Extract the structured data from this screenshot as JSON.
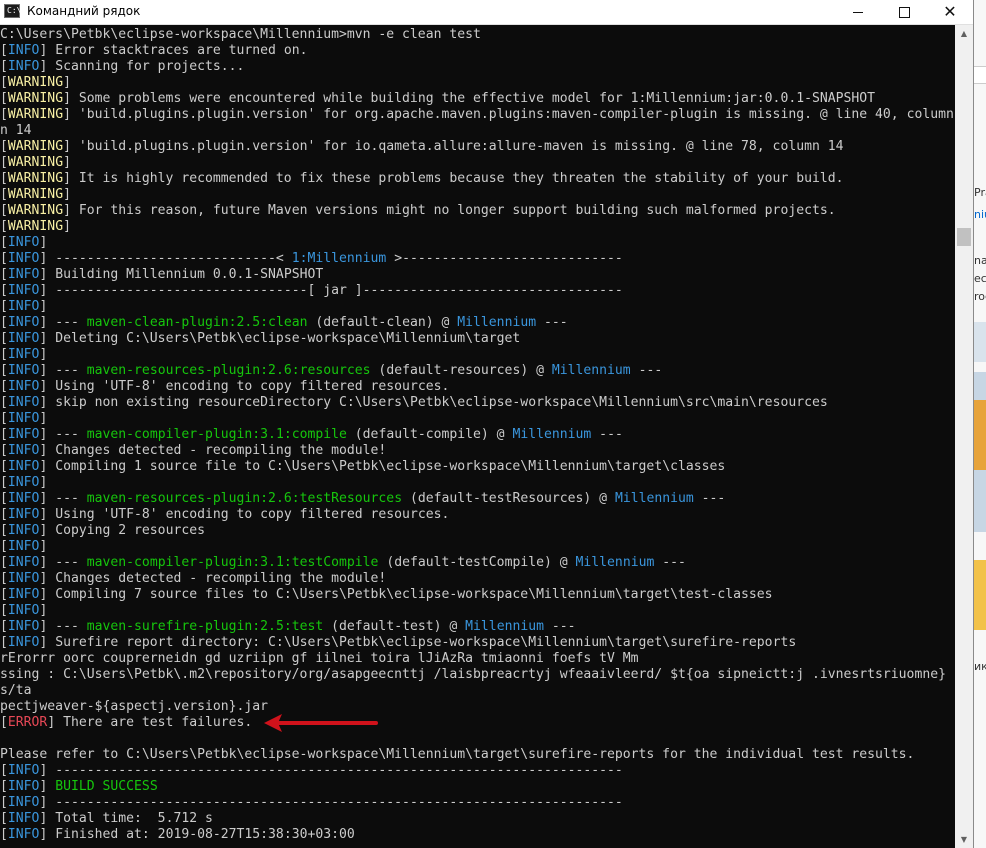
{
  "window": {
    "title": "Командний рядок",
    "controls": {
      "minimize": "minimize",
      "maximize": "maximize",
      "close": "✕"
    },
    "icon_text": "C:\\"
  },
  "console_lines": [
    [
      {
        "t": "C:\\Users\\Petbk\\eclipse-workspace\\Millennium>mvn -e clean test",
        "c": ""
      }
    ],
    [
      {
        "t": "[",
        "c": ""
      },
      {
        "t": "INFO",
        "c": "c-info"
      },
      {
        "t": "] Error stacktraces are turned on.",
        "c": ""
      }
    ],
    [
      {
        "t": "[",
        "c": ""
      },
      {
        "t": "INFO",
        "c": "c-info"
      },
      {
        "t": "] Scanning for projects...",
        "c": ""
      }
    ],
    [
      {
        "t": "[",
        "c": ""
      },
      {
        "t": "WARNING",
        "c": "c-warn"
      },
      {
        "t": "]",
        "c": ""
      }
    ],
    [
      {
        "t": "[",
        "c": ""
      },
      {
        "t": "WARNING",
        "c": "c-warn"
      },
      {
        "t": "] Some problems were encountered while building the effective model for 1:Millennium:jar:0.0.1-SNAPSHOT",
        "c": ""
      }
    ],
    [
      {
        "t": "[",
        "c": ""
      },
      {
        "t": "WARNING",
        "c": "c-warn"
      },
      {
        "t": "] 'build.plugins.plugin.version' for org.apache.maven.plugins:maven-compiler-plugin is missing. @ line 40, column",
        "c": ""
      }
    ],
    [
      {
        "t": "n 14",
        "c": ""
      }
    ],
    [
      {
        "t": "[",
        "c": ""
      },
      {
        "t": "WARNING",
        "c": "c-warn"
      },
      {
        "t": "] 'build.plugins.plugin.version' for io.qameta.allure:allure-maven is missing. @ line 78, column 14",
        "c": ""
      }
    ],
    [
      {
        "t": "[",
        "c": ""
      },
      {
        "t": "WARNING",
        "c": "c-warn"
      },
      {
        "t": "]",
        "c": ""
      }
    ],
    [
      {
        "t": "[",
        "c": ""
      },
      {
        "t": "WARNING",
        "c": "c-warn"
      },
      {
        "t": "] It is highly recommended to fix these problems because they threaten the stability of your build.",
        "c": ""
      }
    ],
    [
      {
        "t": "[",
        "c": ""
      },
      {
        "t": "WARNING",
        "c": "c-warn"
      },
      {
        "t": "]",
        "c": ""
      }
    ],
    [
      {
        "t": "[",
        "c": ""
      },
      {
        "t": "WARNING",
        "c": "c-warn"
      },
      {
        "t": "] For this reason, future Maven versions might no longer support building such malformed projects.",
        "c": ""
      }
    ],
    [
      {
        "t": "[",
        "c": ""
      },
      {
        "t": "WARNING",
        "c": "c-warn"
      },
      {
        "t": "]",
        "c": ""
      }
    ],
    [
      {
        "t": "[",
        "c": ""
      },
      {
        "t": "INFO",
        "c": "c-info"
      },
      {
        "t": "]",
        "c": ""
      }
    ],
    [
      {
        "t": "[",
        "c": ""
      },
      {
        "t": "INFO",
        "c": "c-info"
      },
      {
        "t": "] ----------------------------< ",
        "c": ""
      },
      {
        "t": "1:Millennium",
        "c": "c-blue"
      },
      {
        "t": " >----------------------------",
        "c": ""
      }
    ],
    [
      {
        "t": "[",
        "c": ""
      },
      {
        "t": "INFO",
        "c": "c-info"
      },
      {
        "t": "] Building Millennium 0.0.1-SNAPSHOT",
        "c": ""
      }
    ],
    [
      {
        "t": "[",
        "c": ""
      },
      {
        "t": "INFO",
        "c": "c-info"
      },
      {
        "t": "] --------------------------------[ jar ]---------------------------------",
        "c": ""
      }
    ],
    [
      {
        "t": "[",
        "c": ""
      },
      {
        "t": "INFO",
        "c": "c-info"
      },
      {
        "t": "]",
        "c": ""
      }
    ],
    [
      {
        "t": "[",
        "c": ""
      },
      {
        "t": "INFO",
        "c": "c-info"
      },
      {
        "t": "] --- ",
        "c": ""
      },
      {
        "t": "maven-clean-plugin:2.5:clean",
        "c": "c-green"
      },
      {
        "t": " (default-clean) @ ",
        "c": ""
      },
      {
        "t": "Millennium",
        "c": "c-blue"
      },
      {
        "t": " ---",
        "c": ""
      }
    ],
    [
      {
        "t": "[",
        "c": ""
      },
      {
        "t": "INFO",
        "c": "c-info"
      },
      {
        "t": "] Deleting C:\\Users\\Petbk\\eclipse-workspace\\Millennium\\target",
        "c": ""
      }
    ],
    [
      {
        "t": "[",
        "c": ""
      },
      {
        "t": "INFO",
        "c": "c-info"
      },
      {
        "t": "]",
        "c": ""
      }
    ],
    [
      {
        "t": "[",
        "c": ""
      },
      {
        "t": "INFO",
        "c": "c-info"
      },
      {
        "t": "] --- ",
        "c": ""
      },
      {
        "t": "maven-resources-plugin:2.6:resources",
        "c": "c-green"
      },
      {
        "t": " (default-resources) @ ",
        "c": ""
      },
      {
        "t": "Millennium",
        "c": "c-blue"
      },
      {
        "t": " ---",
        "c": ""
      }
    ],
    [
      {
        "t": "[",
        "c": ""
      },
      {
        "t": "INFO",
        "c": "c-info"
      },
      {
        "t": "] Using 'UTF-8' encoding to copy filtered resources.",
        "c": ""
      }
    ],
    [
      {
        "t": "[",
        "c": ""
      },
      {
        "t": "INFO",
        "c": "c-info"
      },
      {
        "t": "] skip non existing resourceDirectory C:\\Users\\Petbk\\eclipse-workspace\\Millennium\\src\\main\\resources",
        "c": ""
      }
    ],
    [
      {
        "t": "[",
        "c": ""
      },
      {
        "t": "INFO",
        "c": "c-info"
      },
      {
        "t": "]",
        "c": ""
      }
    ],
    [
      {
        "t": "[",
        "c": ""
      },
      {
        "t": "INFO",
        "c": "c-info"
      },
      {
        "t": "] --- ",
        "c": ""
      },
      {
        "t": "maven-compiler-plugin:3.1:compile",
        "c": "c-green"
      },
      {
        "t": " (default-compile) @ ",
        "c": ""
      },
      {
        "t": "Millennium",
        "c": "c-blue"
      },
      {
        "t": " ---",
        "c": ""
      }
    ],
    [
      {
        "t": "[",
        "c": ""
      },
      {
        "t": "INFO",
        "c": "c-info"
      },
      {
        "t": "] Changes detected - recompiling the module!",
        "c": ""
      }
    ],
    [
      {
        "t": "[",
        "c": ""
      },
      {
        "t": "INFO",
        "c": "c-info"
      },
      {
        "t": "] Compiling 1 source file to C:\\Users\\Petbk\\eclipse-workspace\\Millennium\\target\\classes",
        "c": ""
      }
    ],
    [
      {
        "t": "[",
        "c": ""
      },
      {
        "t": "INFO",
        "c": "c-info"
      },
      {
        "t": "]",
        "c": ""
      }
    ],
    [
      {
        "t": "[",
        "c": ""
      },
      {
        "t": "INFO",
        "c": "c-info"
      },
      {
        "t": "] --- ",
        "c": ""
      },
      {
        "t": "maven-resources-plugin:2.6:testResources",
        "c": "c-green"
      },
      {
        "t": " (default-testResources) @ ",
        "c": ""
      },
      {
        "t": "Millennium",
        "c": "c-blue"
      },
      {
        "t": " ---",
        "c": ""
      }
    ],
    [
      {
        "t": "[",
        "c": ""
      },
      {
        "t": "INFO",
        "c": "c-info"
      },
      {
        "t": "] Using 'UTF-8' encoding to copy filtered resources.",
        "c": ""
      }
    ],
    [
      {
        "t": "[",
        "c": ""
      },
      {
        "t": "INFO",
        "c": "c-info"
      },
      {
        "t": "] Copying 2 resources",
        "c": ""
      }
    ],
    [
      {
        "t": "[",
        "c": ""
      },
      {
        "t": "INFO",
        "c": "c-info"
      },
      {
        "t": "]",
        "c": ""
      }
    ],
    [
      {
        "t": "[",
        "c": ""
      },
      {
        "t": "INFO",
        "c": "c-info"
      },
      {
        "t": "] --- ",
        "c": ""
      },
      {
        "t": "maven-compiler-plugin:3.1:testCompile",
        "c": "c-green"
      },
      {
        "t": " (default-testCompile) @ ",
        "c": ""
      },
      {
        "t": "Millennium",
        "c": "c-blue"
      },
      {
        "t": " ---",
        "c": ""
      }
    ],
    [
      {
        "t": "[",
        "c": ""
      },
      {
        "t": "INFO",
        "c": "c-info"
      },
      {
        "t": "] Changes detected - recompiling the module!",
        "c": ""
      }
    ],
    [
      {
        "t": "[",
        "c": ""
      },
      {
        "t": "INFO",
        "c": "c-info"
      },
      {
        "t": "] Compiling 7 source files to C:\\Users\\Petbk\\eclipse-workspace\\Millennium\\target\\test-classes",
        "c": ""
      }
    ],
    [
      {
        "t": "[",
        "c": ""
      },
      {
        "t": "INFO",
        "c": "c-info"
      },
      {
        "t": "]",
        "c": ""
      }
    ],
    [
      {
        "t": "[",
        "c": ""
      },
      {
        "t": "INFO",
        "c": "c-info"
      },
      {
        "t": "] --- ",
        "c": ""
      },
      {
        "t": "maven-surefire-plugin:2.5:test",
        "c": "c-green"
      },
      {
        "t": " (default-test) @ ",
        "c": ""
      },
      {
        "t": "Millennium",
        "c": "c-blue"
      },
      {
        "t": " ---",
        "c": ""
      }
    ],
    [
      {
        "t": "[",
        "c": ""
      },
      {
        "t": "INFO",
        "c": "c-info"
      },
      {
        "t": "] Surefire report directory: C:\\Users\\Petbk\\eclipse-workspace\\Millennium\\target\\surefire-reports",
        "c": ""
      }
    ],
    [
      {
        "t": "rErorrr oorc couprerneidn gd uzriipn gf iilnei toira lJiAzRa tmiaonni foefs tV Mm",
        "c": ""
      }
    ],
    [
      {
        "t": "ssing : C:\\Users\\Petbk\\.m2\\repository/org/asapgeecnttj /laisbpreacrtyj wfeaaivleerd/ $t{oa sipneictt:j .ivnesrtsriuomne}",
        "c": ""
      }
    ],
    [
      {
        "t": "s/ta",
        "c": ""
      }
    ],
    [
      {
        "t": "pectjweaver-${aspectj.version}.jar",
        "c": ""
      }
    ],
    [
      {
        "t": "[",
        "c": ""
      },
      {
        "t": "ERROR",
        "c": "c-err"
      },
      {
        "t": "] There are test failures.",
        "c": ""
      }
    ],
    [
      {
        "t": "",
        "c": ""
      }
    ],
    [
      {
        "t": "Please refer to C:\\Users\\Petbk\\eclipse-workspace\\Millennium\\target\\surefire-reports for the individual test results.",
        "c": ""
      }
    ],
    [
      {
        "t": "[",
        "c": ""
      },
      {
        "t": "INFO",
        "c": "c-info"
      },
      {
        "t": "] ------------------------------------------------------------------------",
        "c": ""
      }
    ],
    [
      {
        "t": "[",
        "c": ""
      },
      {
        "t": "INFO",
        "c": "c-info"
      },
      {
        "t": "] ",
        "c": ""
      },
      {
        "t": "BUILD SUCCESS",
        "c": "c-green"
      }
    ],
    [
      {
        "t": "[",
        "c": ""
      },
      {
        "t": "INFO",
        "c": "c-info"
      },
      {
        "t": "] ------------------------------------------------------------------------",
        "c": ""
      }
    ],
    [
      {
        "t": "[",
        "c": ""
      },
      {
        "t": "INFO",
        "c": "c-info"
      },
      {
        "t": "] Total time:  5.712 s",
        "c": ""
      }
    ],
    [
      {
        "t": "[",
        "c": ""
      },
      {
        "t": "INFO",
        "c": "c-info"
      },
      {
        "t": "] Finished at: 2019-08-27T15:38:30+03:00",
        "c": ""
      }
    ]
  ],
  "background_app": {
    "fragments": [
      "Pra",
      "niu",
      "nac",
      "eci",
      "roc",
      "ик"
    ]
  },
  "colors": {
    "console_bg": "#0c0c0c",
    "console_text": "#cccccc",
    "info": "#3a96dd",
    "warning": "#f9f1a5",
    "error": "#e74856",
    "green": "#16c60c",
    "annotation_arrow": "#d0121b"
  }
}
